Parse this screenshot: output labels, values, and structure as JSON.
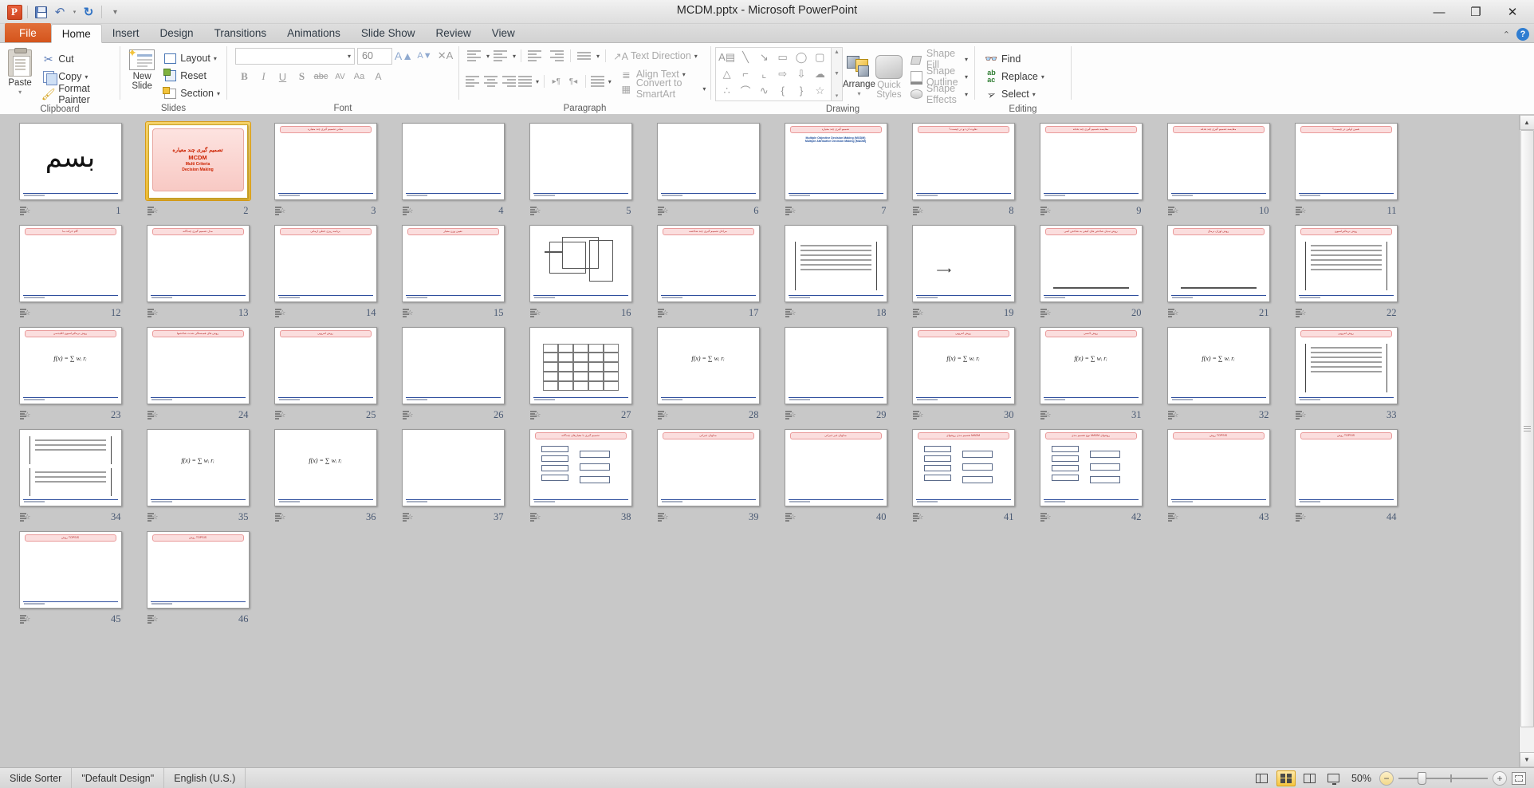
{
  "window": {
    "title": "MCDM.pptx  -  Microsoft PowerPoint",
    "minimize": "—",
    "restore": "❐",
    "close": "✕"
  },
  "quick_access": {
    "app_logo": "P",
    "save": "save-icon",
    "undo": "↶",
    "redo": "↻",
    "customize": "▾"
  },
  "tabs": [
    {
      "label": "File",
      "active": false,
      "kind": "file"
    },
    {
      "label": "Home",
      "active": true,
      "kind": "normal"
    },
    {
      "label": "Insert",
      "active": false,
      "kind": "normal"
    },
    {
      "label": "Design",
      "active": false,
      "kind": "normal"
    },
    {
      "label": "Transitions",
      "active": false,
      "kind": "normal"
    },
    {
      "label": "Animations",
      "active": false,
      "kind": "normal"
    },
    {
      "label": "Slide Show",
      "active": false,
      "kind": "normal"
    },
    {
      "label": "Review",
      "active": false,
      "kind": "normal"
    },
    {
      "label": "View",
      "active": false,
      "kind": "normal"
    }
  ],
  "tab_right": {
    "collapse": "⌃",
    "help": "?"
  },
  "ribbon": {
    "clipboard": {
      "group_label": "Clipboard",
      "paste": "Paste",
      "paste_caret": "▾",
      "cut": "Cut",
      "copy": "Copy",
      "copy_caret": "▾",
      "format_painter": "Format Painter",
      "launcher": "⤵"
    },
    "slides": {
      "group_label": "Slides",
      "new_slide_line1": "New",
      "new_slide_line2": "Slide",
      "new_slide_caret": "▾",
      "layout": "Layout",
      "layout_caret": "▾",
      "reset": "Reset",
      "section": "Section",
      "section_caret": "▾"
    },
    "font": {
      "group_label": "Font",
      "font_name": "",
      "font_name_caret": "▾",
      "font_size": "60",
      "grow_font": "A",
      "shrink_font": "A",
      "clear_formatting": "A",
      "bold": "B",
      "italic": "I",
      "underline": "U",
      "shadow": "S",
      "strikethrough": "abc",
      "char_spacing": "AV",
      "change_case": "Aa",
      "font_color": "A",
      "launcher": "⤵"
    },
    "paragraph": {
      "group_label": "Paragraph",
      "bullets": "•≡",
      "numbering": "1≡",
      "decrease_indent": "←≡",
      "increase_indent": "→≡",
      "line_spacing": "↕≡",
      "align_left": "align-left",
      "center": "center",
      "align_right": "align-right",
      "justify": "justify",
      "columns": "≡≡",
      "ltr": "▸¶",
      "rtl": "¶◂",
      "text_direction": "Text Direction",
      "align_text": "Align Text",
      "convert_to_smartart": "Convert to SmartArt",
      "launcher": "⤵"
    },
    "drawing": {
      "group_label": "Drawing",
      "shapes": [
        "A▤",
        "╲",
        "↘",
        "▭",
        "◯",
        "▢",
        "△",
        "⌐",
        "⌞",
        "⇨",
        "⇩",
        "☁",
        "∴",
        "⌒",
        "∿",
        "{",
        "}",
        "☆"
      ],
      "gallery_up": "▲",
      "gallery_down": "▼",
      "gallery_more": "▾",
      "arrange": "Arrange",
      "arrange_caret": "▾",
      "quick_styles_line1": "Quick",
      "quick_styles_line2": "Styles",
      "quick_styles_caret": "▾",
      "shape_fill": "Shape Fill",
      "shape_outline": "Shape Outline",
      "shape_effects": "Shape Effects",
      "caret": "▾",
      "launcher": "⤵"
    },
    "editing": {
      "group_label": "Editing",
      "find": "Find",
      "replace": "Replace",
      "replace_caret": "▾",
      "select": "Select",
      "select_caret": "▾"
    }
  },
  "sorter": {
    "selected_slide": 2,
    "slides": [
      {
        "n": 1,
        "kind": "calligraphy",
        "title": "",
        "lines": 0
      },
      {
        "n": 2,
        "kind": "title",
        "title_fa": "تصمیم گیری چند معیاره",
        "title_abbr": "MCDM",
        "sub1": "Multi Criteria",
        "sub2": "Decision Making"
      },
      {
        "n": 3,
        "kind": "bullets",
        "title": "مبانی تصمیم گیری چند معیاره",
        "lines": 7
      },
      {
        "n": 4,
        "kind": "text",
        "title": "",
        "lines": 8
      },
      {
        "n": 5,
        "kind": "text",
        "title": "",
        "lines": 8
      },
      {
        "n": 6,
        "kind": "text",
        "title": "",
        "lines": 9
      },
      {
        "n": 7,
        "kind": "bullets-en",
        "title": "تصمیم گیری چند معیاره",
        "en1": "Multiple Objective Decision Making    (MODM)",
        "en2": "Multiple Attributive Decision Making  (MADM)",
        "lines": 3
      },
      {
        "n": 8,
        "kind": "bullets",
        "title": "تفاوت آن دو در چیست؟",
        "lines": 5
      },
      {
        "n": 9,
        "kind": "bullets",
        "title": "مقایسه تصمیم گیری چند هدفه",
        "lines": 7
      },
      {
        "n": 10,
        "kind": "bullets",
        "title": "مقایسه تصمیم گیری چند هدفه",
        "lines": 7
      },
      {
        "n": 11,
        "kind": "bullets",
        "title": "همین اولین در چیست؟",
        "lines": 6
      },
      {
        "n": 12,
        "kind": "bullets",
        "title": "گام حرکت ما",
        "lines": 7
      },
      {
        "n": 13,
        "kind": "bullets",
        "title": "مدل تصمیم گیری چندگانه",
        "lines": 7
      },
      {
        "n": 14,
        "kind": "bullets",
        "title": "برنامه ریزی خطی آرمانی",
        "lines": 6
      },
      {
        "n": 15,
        "kind": "bullets",
        "title": "تعیین وزن معیار",
        "lines": 7
      },
      {
        "n": 16,
        "kind": "diagram3d",
        "title": "",
        "lines": 0
      },
      {
        "n": 17,
        "kind": "list-num",
        "title": "مراحل تصمیم گیری چند شاخصه",
        "lines": 9
      },
      {
        "n": 18,
        "kind": "matrix",
        "title": "",
        "lines": 0
      },
      {
        "n": 19,
        "kind": "arrow",
        "title": "",
        "lines": 3
      },
      {
        "n": 20,
        "kind": "axis",
        "title": "روش تبدیل شاخص های کیفی به شاخص کمی",
        "lines": 4
      },
      {
        "n": 21,
        "kind": "axis",
        "title": "روش اوزان نرمال",
        "lines": 4
      },
      {
        "n": 22,
        "kind": "matrix",
        "title": "روش نرمالیزاسیون",
        "lines": 3
      },
      {
        "n": 23,
        "kind": "formula",
        "title": "روش نرمالیزاسیون اقلیدسی",
        "lines": 2
      },
      {
        "n": 24,
        "kind": "text",
        "title": "روش های همبستگی شدت شاخصها",
        "lines": 8
      },
      {
        "n": 25,
        "kind": "text",
        "title": "روش آنتروپی",
        "lines": 8
      },
      {
        "n": 26,
        "kind": "text",
        "title": "",
        "lines": 8
      },
      {
        "n": 27,
        "kind": "table",
        "title": "",
        "lines": 0
      },
      {
        "n": 28,
        "kind": "formula",
        "title": "",
        "lines": 6
      },
      {
        "n": 29,
        "kind": "text",
        "title": "",
        "lines": 8
      },
      {
        "n": 30,
        "kind": "formula",
        "title": "روش انتروپی",
        "lines": 5
      },
      {
        "n": 31,
        "kind": "formula",
        "title": "روش لانسی",
        "lines": 5
      },
      {
        "n": 32,
        "kind": "formula",
        "title": "",
        "lines": 6
      },
      {
        "n": 33,
        "kind": "matrix",
        "title": "روش آنتروپی",
        "lines": 4
      },
      {
        "n": 34,
        "kind": "matrix2",
        "title": "",
        "lines": 0
      },
      {
        "n": 35,
        "kind": "formula",
        "title": "",
        "lines": 6
      },
      {
        "n": 36,
        "kind": "formula",
        "title": "",
        "lines": 6
      },
      {
        "n": 37,
        "kind": "list-num",
        "title": "",
        "lines": 8
      },
      {
        "n": 38,
        "kind": "flow",
        "title": "تصمیم گیری با معیارهای چندگانه",
        "lines": 4
      },
      {
        "n": 39,
        "kind": "text",
        "title": "مدلهای جبرانی",
        "lines": 6
      },
      {
        "n": 40,
        "kind": "text",
        "title": "مدلهای غیر جبرانی",
        "lines": 8
      },
      {
        "n": 41,
        "kind": "flow",
        "title": "تقسیم بندی روشهای MADM",
        "lines": 0
      },
      {
        "n": 42,
        "kind": "flow",
        "title": "نوع تقسیم بندی MADM روشهای",
        "lines": 0
      },
      {
        "n": 43,
        "kind": "text",
        "title": "روش TOPSIS",
        "lines": 9
      },
      {
        "n": 44,
        "kind": "text",
        "title": "روش TOPSIS",
        "lines": 9
      },
      {
        "n": 45,
        "kind": "text",
        "title": "روش TOPSIS",
        "lines": 9
      },
      {
        "n": 46,
        "kind": "text",
        "title": "روش TOPSIS",
        "lines": 9
      }
    ]
  },
  "scrollbar": {
    "up": "▲",
    "down": "▼"
  },
  "status": {
    "view": "Slide Sorter",
    "theme": "\"Default Design\"",
    "language": "English (U.S.)",
    "zoom_percent": "50%",
    "zoom_out": "−",
    "zoom_in": "+",
    "view_buttons": [
      "normal-view",
      "slide-sorter-view",
      "reading-view",
      "slide-show-view"
    ],
    "active_view_button": "slide-sorter-view",
    "fit_to_window": "fit-slide-to-window"
  },
  "colors": {
    "accent_orange": "#d4541c",
    "selection_gold": "#edbc33",
    "title_red": "#c0392b",
    "link_blue": "#1f4e9c"
  }
}
